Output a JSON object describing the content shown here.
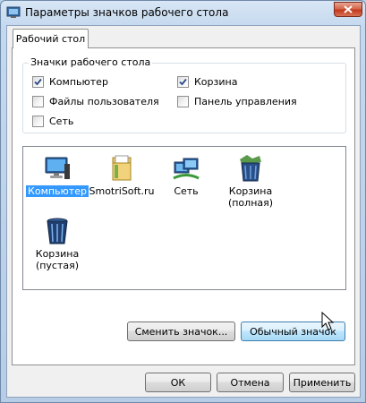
{
  "window": {
    "title": "Параметры значков рабочего стола"
  },
  "tabs": [
    {
      "label": "Рабочий стол"
    }
  ],
  "group": {
    "legend": "Значки рабочего стола",
    "checkboxes": [
      {
        "label": "Компьютер",
        "checked": true
      },
      {
        "label": "Корзина",
        "checked": true
      },
      {
        "label": "Файлы пользователя",
        "checked": false
      },
      {
        "label": "Панель управления",
        "checked": false
      },
      {
        "label": "Сеть",
        "checked": false
      }
    ]
  },
  "icons": [
    {
      "label": "Компьютер",
      "icon": "computer-icon",
      "selected": true
    },
    {
      "label": "SmotriSoft.ru",
      "icon": "user-folder-icon",
      "selected": false
    },
    {
      "label": "Сеть",
      "icon": "network-icon",
      "selected": false
    },
    {
      "label": "Корзина\n(полная)",
      "icon": "recycle-bin-full-icon",
      "selected": false
    },
    {
      "label": "Корзина\n(пустая)",
      "icon": "recycle-bin-empty-icon",
      "selected": false
    }
  ],
  "buttons": {
    "change_icon": "Сменить значок...",
    "default_icon": "Обычный значок",
    "ok": "ОК",
    "cancel": "Отмена",
    "apply": "Применить"
  }
}
